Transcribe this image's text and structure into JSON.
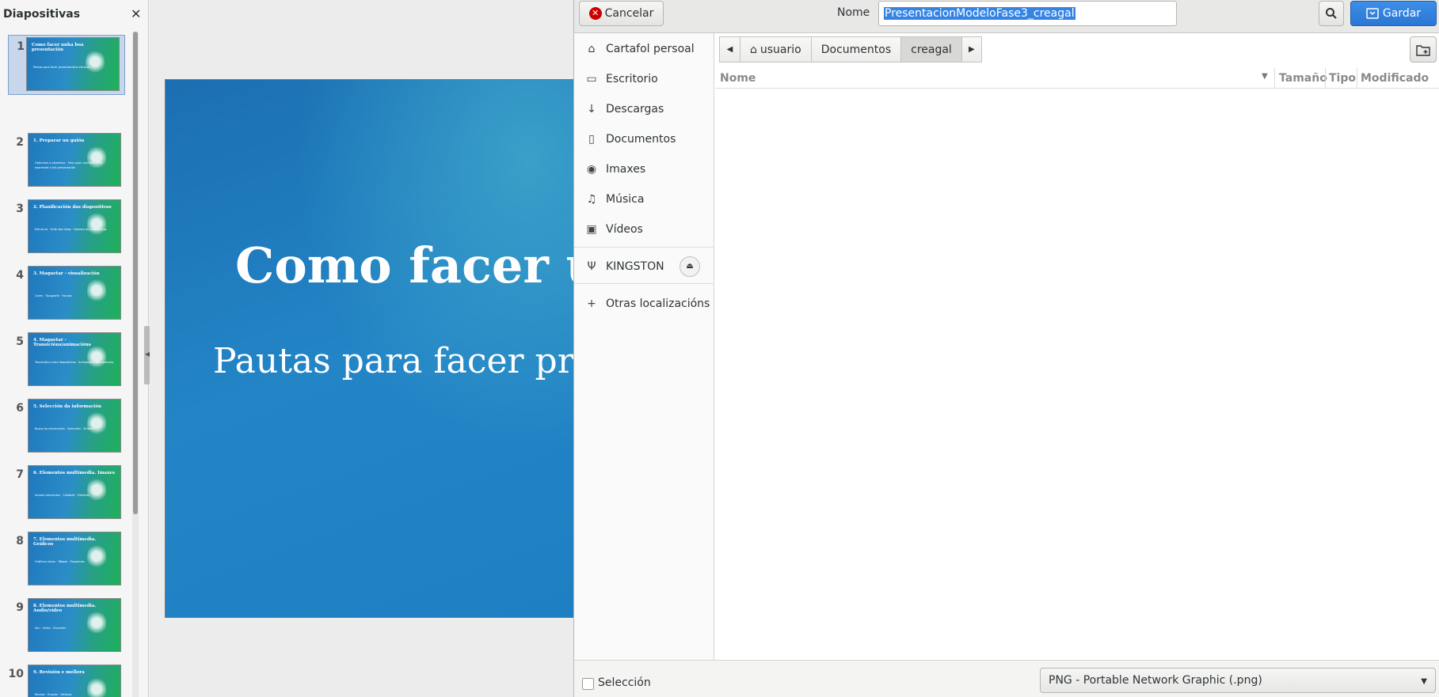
{
  "slides_pane": {
    "title": "Diapositivas",
    "close_icon": "close-icon",
    "slides": [
      {
        "number": "1",
        "title": "Como facer unha boa presentación",
        "body": "Pautas para facer presentacións eficaces"
      },
      {
        "number": "2",
        "title": "1. Preparar un guión",
        "body": "Optimizar o obxectivo · Para quen vas falar · Que expresará a túa presentación"
      },
      {
        "number": "3",
        "title": "2. Planificación das diapositivas",
        "body": "Estrutura · Orde das ideas · Número de diapositivas"
      },
      {
        "number": "4",
        "title": "3. Maquetar - visualización",
        "body": "Cores · Tipografía · Fondos"
      },
      {
        "number": "5",
        "title": "4. Maquetar - Transicións/animacións",
        "body": "Transicións entre diapositivas · Animacións dos obxectos"
      },
      {
        "number": "6",
        "title": "5. Selección da información",
        "body": "Busca da información · Selección · Síntese"
      },
      {
        "number": "7",
        "title": "6. Elementos multimedia. Imaxes",
        "body": "Imaxes relevantes · Calidade · Dereitos"
      },
      {
        "number": "8",
        "title": "7. Elementos multimedia. Gráficos",
        "body": "Gráficos claros · Táboas · Esquemas"
      },
      {
        "number": "9",
        "title": "8. Elementos multimedia. Audio/vídeo",
        "body": "Son · Vídeo · Duración"
      },
      {
        "number": "10",
        "title": "9. Revisión e mellora",
        "body": "Revisar · Ensaiar · Mellorar"
      }
    ]
  },
  "slide_main": {
    "title": "Como facer unha boa presentación",
    "subtitle": "Pautas para facer presentacións eficaces"
  },
  "dialog": {
    "cancel_label": "Cancelar",
    "name_label": "Nome",
    "filename_value": "PresentacionModeloFase3_creagal",
    "save_label": "Gardar",
    "places": [
      {
        "label": "Cartafol persoal",
        "icon": "home-icon"
      },
      {
        "label": "Escritorio",
        "icon": "folder-icon"
      },
      {
        "label": "Descargas",
        "icon": "download-icon"
      },
      {
        "label": "Documentos",
        "icon": "document-icon"
      },
      {
        "label": "Imaxes",
        "icon": "camera-icon"
      },
      {
        "label": "Música",
        "icon": "music-icon"
      },
      {
        "label": "Vídeos",
        "icon": "video-icon"
      },
      {
        "label": "KINGSTON",
        "icon": "usb-icon"
      },
      {
        "label": "Otras localizacións",
        "icon": "plus-icon"
      }
    ],
    "path": [
      "usuario",
      "Documentos",
      "creagal"
    ],
    "columns": [
      "Nome",
      "Tamaño",
      "Tipo",
      "Modificado"
    ],
    "selection_label": "Selección",
    "file_type": "PNG - Portable Network Graphic (.png)"
  }
}
